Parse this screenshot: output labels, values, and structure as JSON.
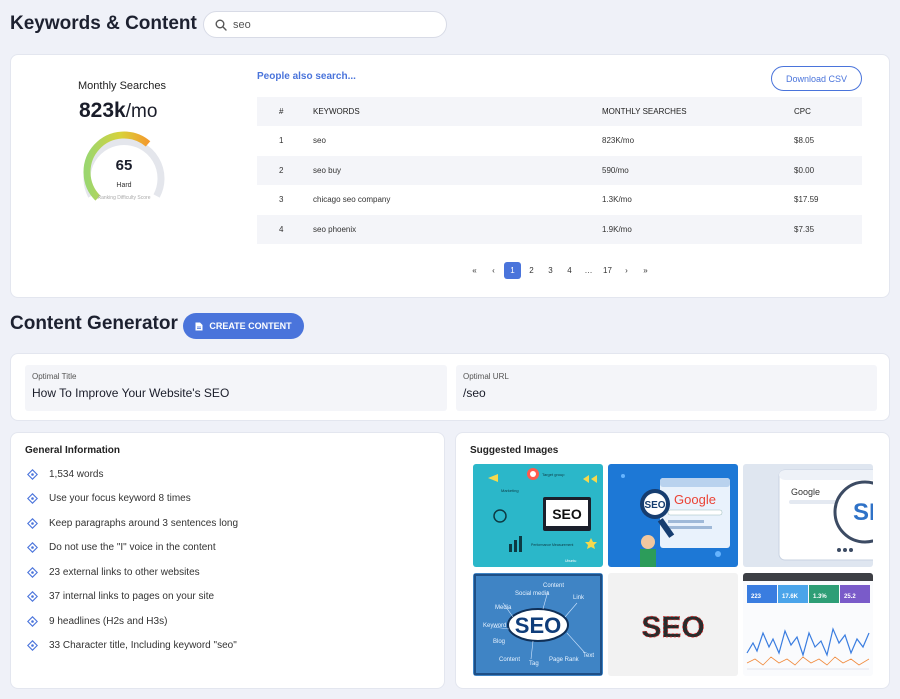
{
  "header": {
    "title": "Keywords & Content",
    "search_value": "seo"
  },
  "monthly": {
    "label": "Monthly Searches",
    "value": "823k",
    "unit": "/mo",
    "difficulty": "65",
    "difficulty_level": "Hard",
    "difficulty_caption": "Ranking Difficulty Score",
    "difficulty_fraction": 0.65
  },
  "people_also": {
    "title": "People also search...",
    "download_label": "Download CSV",
    "columns": [
      "#",
      "KEYWORDS",
      "MONTHLY SEARCHES",
      "CPC"
    ],
    "rows": [
      [
        "1",
        "seo",
        "823K/mo",
        "$8.05"
      ],
      [
        "2",
        "seo buy",
        "590/mo",
        "$0.00"
      ],
      [
        "3",
        "chicago seo company",
        "1.3K/mo",
        "$17.59"
      ],
      [
        "4",
        "seo phoenix",
        "1.9K/mo",
        "$7.35"
      ]
    ],
    "pagination": {
      "first": "«",
      "prev": "‹",
      "pages": [
        "1",
        "2",
        "3",
        "4"
      ],
      "ellipsis": "…",
      "last_page": "17",
      "next": "›",
      "last": "»",
      "active": "1"
    }
  },
  "content_generator": {
    "title": "Content Generator",
    "button_label": "CREATE CONTENT",
    "optimal_title_label": "Optimal Title",
    "optimal_title_value": "How To Improve Your Website's SEO",
    "optimal_url_label": "Optimal URL",
    "optimal_url_value": "/seo"
  },
  "general_info": {
    "title": "General Information",
    "items": [
      "1,534 words",
      "Use your focus keyword 8 times",
      "Keep paragraphs around 3 sentences long",
      "Do not use the \"I\" voice in the content",
      "23 external links to other websites",
      "37 internal links to pages on your site",
      "9 headlines (H2s and H3s)",
      "33 Character title, Including keyword \"seo\""
    ]
  },
  "suggested_images": {
    "title": "Suggested Images",
    "image_texts": {
      "img1_main": "SEO",
      "img1_labels": [
        "Target group",
        "Marketing",
        "Performance Measurement",
        "Ubuntu"
      ],
      "img2_main": "SEO",
      "img2_brand": "Google",
      "img3_brand": "Google",
      "img3_main": "SE",
      "img4_main": "SEO",
      "img4_words": [
        "Social media",
        "Content",
        "Link",
        "Keyword",
        "Blog",
        "Content",
        "Tag",
        "Page Rank",
        "Text",
        "Media"
      ],
      "img5_main": "SEO",
      "img6_stats": [
        "223",
        "17.6K",
        "1.3%",
        "25.2"
      ]
    }
  },
  "icons": {
    "search": "search-icon",
    "diamond": "diamond-bullet-icon",
    "document": "document-icon"
  },
  "colors": {
    "accent": "#4a74db",
    "background": "#eff1f8",
    "gauge_start": "#8fd16b",
    "gauge_end": "#f39a2d"
  }
}
